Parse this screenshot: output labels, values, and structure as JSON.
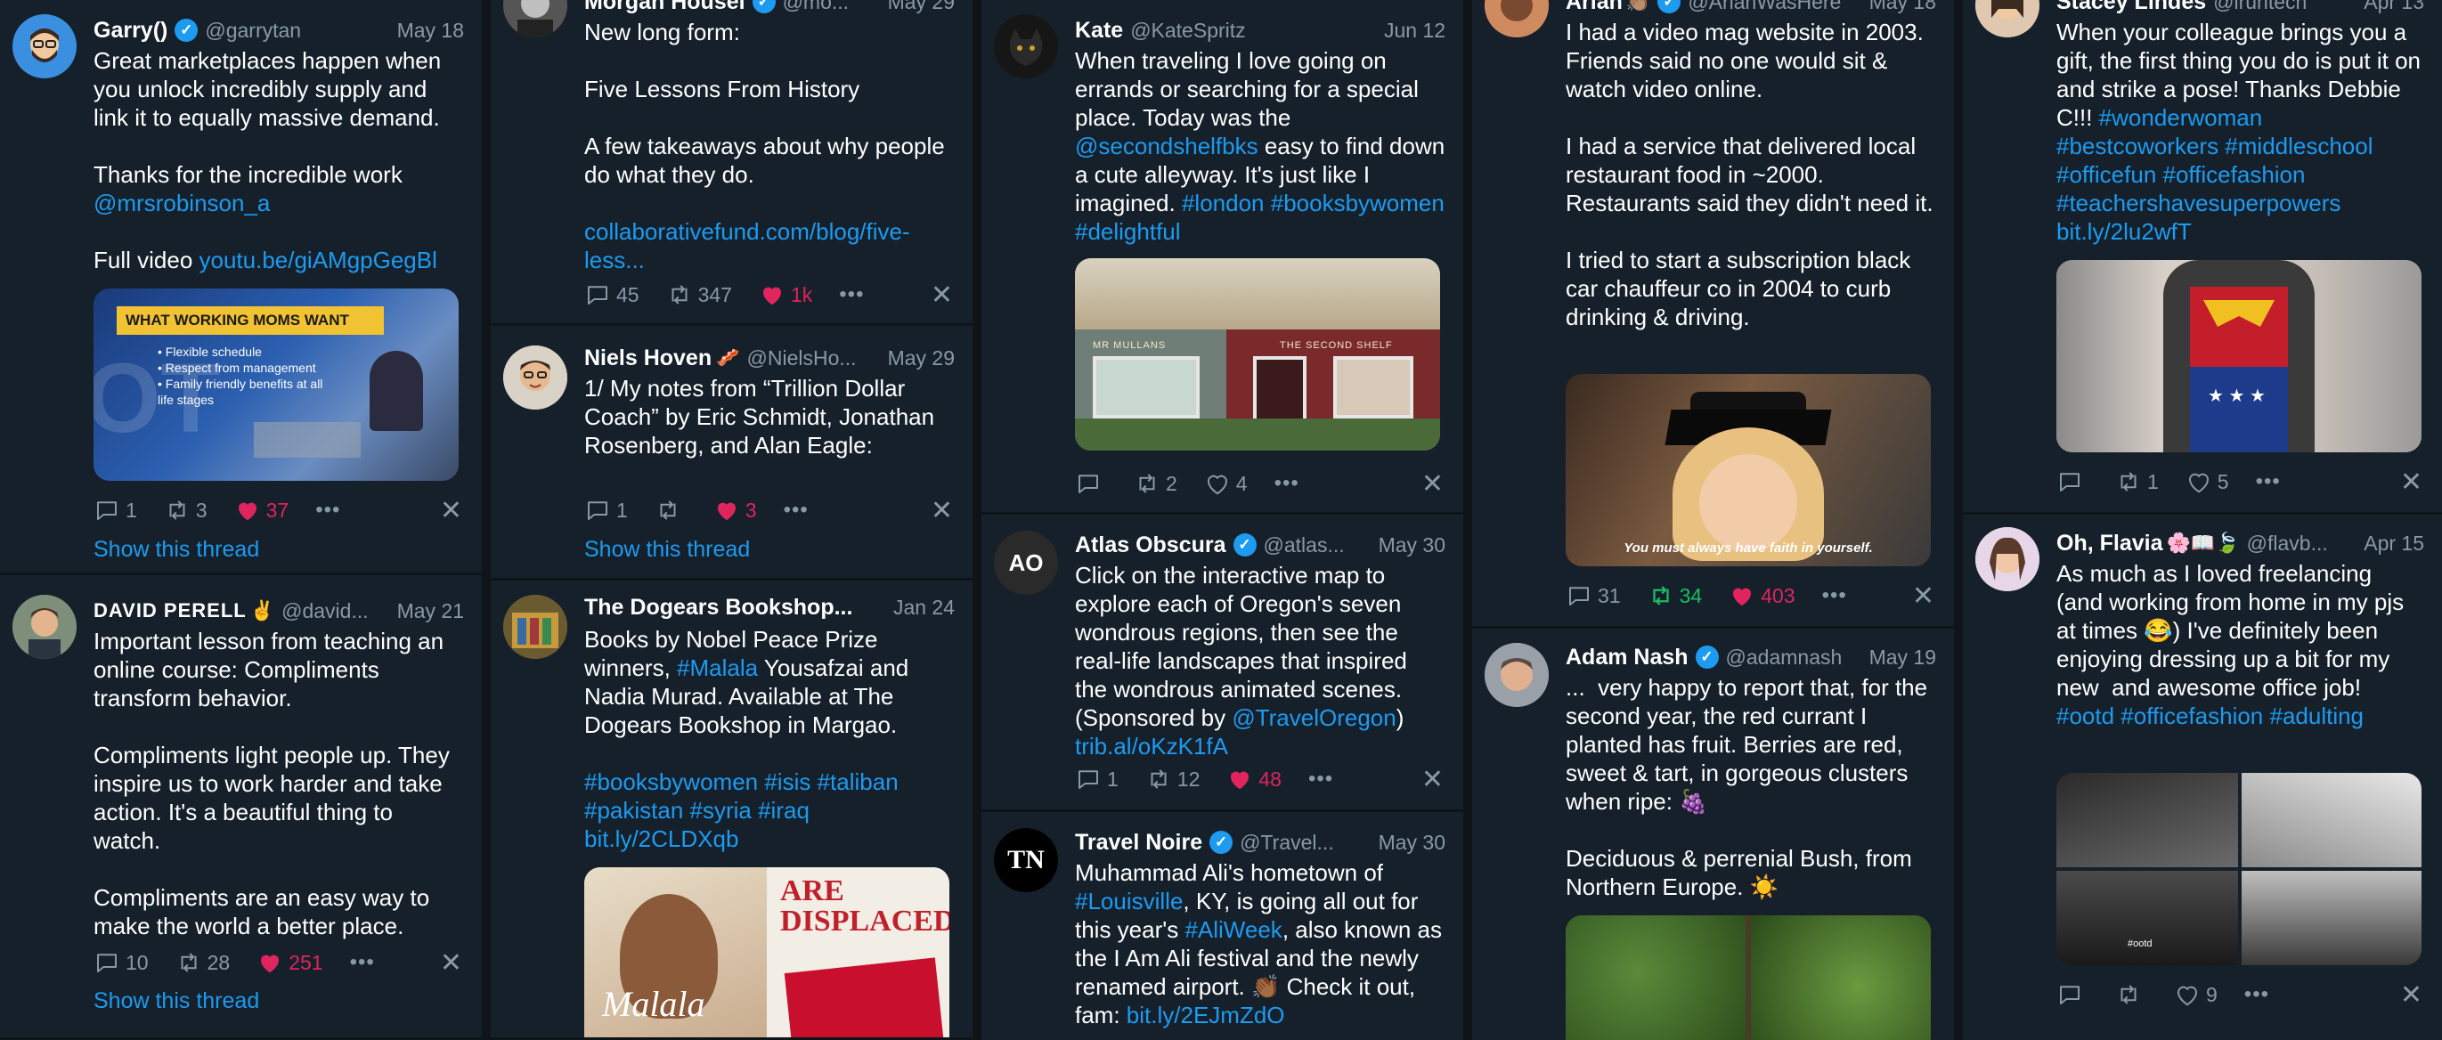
{
  "columns": [
    {
      "tweets": [
        {
          "name": "Garry()",
          "verified": true,
          "handle": "@garrytan",
          "date": "May 18",
          "text_segments": [
            "Great marketplaces happen when you unlock incredibly supply and link it to equally massive demand.\n\nThanks for the incredible work ",
            "@mrsrobinson_a",
            "\n\nFull video ",
            "youtu.be/giAMgpGegBl"
          ],
          "media_title": "WHAT WORKING MOMS WANT",
          "media_bullets": [
            "• Flexible schedule",
            "• Respect from management",
            "• Family friendly benefits at all life stages"
          ],
          "media_logo": "OT",
          "replies": "1",
          "retweets": "3",
          "likes": "37",
          "show_thread": "Show this thread"
        },
        {
          "name": "DAVID PERELL",
          "emoji": "✌",
          "handle": "@david...",
          "date": "May 21",
          "text": "Important lesson from teaching an online course: Compliments transform behavior.\n\nCompliments light people up. They inspire us to work harder and take action. It's a beautiful thing to watch.\n\nCompliments are an easy way to make the world a better place.",
          "replies": "10",
          "retweets": "28",
          "likes": "251",
          "show_thread": "Show this thread"
        }
      ]
    },
    {
      "tweets": [
        {
          "name": "Morgan Housel",
          "verified": true,
          "handle": "@mo...",
          "date": "May 29",
          "text_segments": [
            "New long form:\n\nFive Lessons From History\n\nA few takeaways about why people do what they do.\n\n",
            "collaborativefund.com/blog/five-less..."
          ],
          "replies": "45",
          "retweets": "347",
          "likes": "1k"
        },
        {
          "name": "Niels Hoven",
          "emoji": "🥓",
          "handle": "@NielsHo...",
          "date": "May 29",
          "text": "1/ My notes from “Trillion Dollar Coach” by Eric Schmidt, Jonathan Rosenberg, and Alan Eagle:",
          "replies": "1",
          "retweets": "",
          "likes": "3",
          "show_thread": "Show this thread"
        },
        {
          "name": "The Dogears Bookshop...",
          "date": "Jan 24",
          "text_segments": [
            "Books by Nobel Peace Prize winners, ",
            "#Malala",
            " Yousafzai and Nadia Murad. Available at The Dogears Bookshop in Margao.\n\n",
            "#booksbywomen #isis #taliban #pakistan #syria #iraq bit.ly/2CLDXqb"
          ],
          "media_book1": "Malala",
          "media_book2": "ARE DISPLACED"
        }
      ]
    },
    {
      "tweets": [
        {
          "name": "Kate",
          "handle": "@KateSpritz",
          "date": "Jun 12",
          "text_segments": [
            "When traveling I love going on errands or searching for a special place. Today was the ",
            "@secondshelfbks",
            " easy to find down a cute alleyway. It's just like I imagined. ",
            "#london #booksbywomen #delightful"
          ],
          "media_sign1": "MR MULLANS",
          "media_sign2": "THE SECOND SHELF",
          "replies": "",
          "retweets": "2",
          "likes": "4"
        },
        {
          "name": "Atlas Obscura",
          "verified": true,
          "handle": "@atlas...",
          "date": "May 30",
          "avatar_text": "AO",
          "text_segments": [
            "Click on the interactive map to explore each of Oregon's seven wondrous regions, then see the real-life landscapes that inspired the wondrous animated scenes. (Sponsored by ",
            "@TravelOregon",
            ")\n",
            "trib.al/oKzK1fA"
          ],
          "replies": "1",
          "retweets": "12",
          "likes": "48"
        },
        {
          "name": "Travel Noire",
          "verified": true,
          "handle": "@Travel...",
          "date": "May 30",
          "avatar_text": "TN",
          "text_segments": [
            "Muhammad Ali's hometown of ",
            "#Louisville",
            ", KY, is going all out for this year's ",
            "#AliWeek",
            ", also known as the I Am Ali festival and the newly renamed airport. 👏🏾 Check it out, fam: ",
            "bit.ly/2EJmZdO"
          ]
        }
      ]
    },
    {
      "tweets": [
        {
          "name": "Arian",
          "emoji": "👏🏽",
          "verified": true,
          "handle": "@ArianWasHere",
          "date": "May 18",
          "text": "I had a video mag website in 2003. Friends said no one would sit & watch video online.\n\nI had a service that delivered local restaurant food in ~2000. Restaurants said they didn't need it.\n\nI tried to start a subscription black car chauffeur co in 2004 to curb drinking & driving.",
          "media_caption": "You must always have faith in yourself.",
          "replies": "31",
          "retweets": "34",
          "likes": "403"
        },
        {
          "name": "Adam Nash",
          "verified": true,
          "handle": "@adamnash",
          "date": "May 19",
          "text": "...  very happy to report that, for the second year, the red currant I planted has fruit. Berries are red, sweet & tart, in gorgeous clusters when ripe: 🍇\n\nDeciduous & perrenial Bush, from Northern Europe. ☀️"
        }
      ]
    },
    {
      "tweets": [
        {
          "name": "Stacey Lindes",
          "handle": "@lruhtech",
          "date": "Apr 13",
          "text_segments": [
            "When your colleague brings you a gift, the first thing you do is put it on and strike a pose! Thanks Debbie C!!! ",
            "#wonderwoman #bestcoworkers #middleschool #officefun #officefashion #teachershavesuperpowers bit.ly/2lu2wfT"
          ],
          "replies": "",
          "retweets": "1",
          "likes": "5"
        },
        {
          "name": "Oh, Flavia",
          "emoji": "🌸📖🍃",
          "handle": "@flavb...",
          "date": "Apr 15",
          "text_segments": [
            "As much as I loved freelancing (and working from home in my pjs at times 😂) I've definitely been enjoying dressing up a bit for my new  and awesome office job! ",
            "#ootd #officefashion #adulting"
          ],
          "media_caption": "#ootd",
          "replies": "",
          "retweets": "",
          "likes": "9"
        }
      ]
    }
  ],
  "icons": {
    "more": "•••",
    "close": "✕",
    "verified": "✓"
  },
  "colors": {
    "bg": "#15202b",
    "link": "#1d9bf0",
    "like": "#e0245e",
    "retweet": "#17bf63",
    "muted": "#8899a6"
  }
}
